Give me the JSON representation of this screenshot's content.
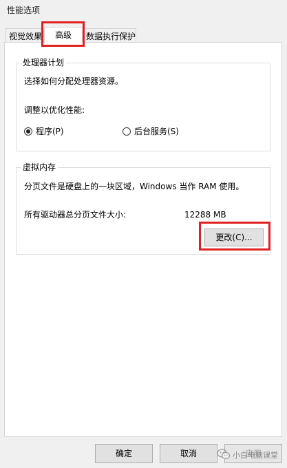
{
  "window": {
    "title": "性能选项"
  },
  "tabs": [
    {
      "label": "视觉效果"
    },
    {
      "label": "高级"
    },
    {
      "label": "数据执行保护"
    }
  ],
  "processor_group": {
    "title": "处理器计划",
    "description": "选择如何分配处理器资源。",
    "optimize_label": "调整以优化性能:",
    "options": [
      {
        "label": "程序(P)",
        "checked": true
      },
      {
        "label": "后台服务(S)",
        "checked": false
      }
    ]
  },
  "virtual_memory_group": {
    "title": "虚拟内存",
    "description": "分页文件是硬盘上的一块区域，Windows 当作 RAM 使用。",
    "total_label": "所有驱动器总分页文件大小:",
    "total_value": "12288 MB",
    "change_button": "更改(C)..."
  },
  "footer": {
    "ok": "确定",
    "cancel": "取消",
    "apply": "应用"
  },
  "watermark": {
    "text": "小白电脑课堂",
    "icon": "wechat-icon"
  },
  "colors": {
    "highlight": "#e02020",
    "panel": "#ffffff",
    "window": "#f0f0f0"
  }
}
